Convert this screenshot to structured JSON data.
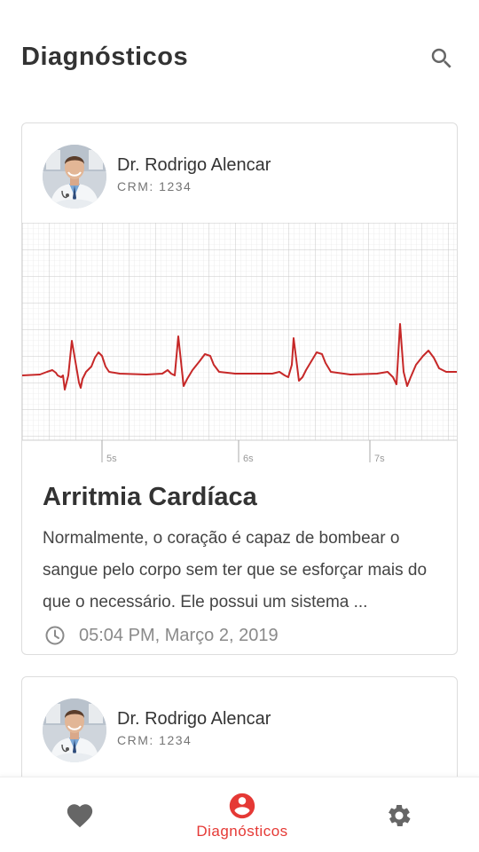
{
  "header": {
    "title": "Diagnósticos",
    "search_icon": "search-icon"
  },
  "cards": [
    {
      "doctor": {
        "name": "Dr. Rodrigo Alencar",
        "crm": "CRM: 1234"
      },
      "ecg_ticks": [
        "5s",
        "6s",
        "7s"
      ],
      "diagnosis": {
        "title": "Arritmia Cardíaca",
        "description": "Normalmente, o coração é capaz de bombear o sangue pelo corpo sem ter que se esforçar mais do que o necessário. Ele possui um sistema ...",
        "timestamp": "05:04 PM, Março 2, 2019"
      }
    },
    {
      "doctor": {
        "name": "Dr. Rodrigo Alencar",
        "crm": "CRM: 1234"
      }
    }
  ],
  "bottom_nav": {
    "items": [
      {
        "icon": "heart-icon",
        "label": "",
        "active": false
      },
      {
        "icon": "account-circle-icon",
        "label": "Diagnósticos",
        "active": true
      },
      {
        "icon": "gear-icon",
        "label": "",
        "active": false
      }
    ]
  },
  "colors": {
    "accent": "#e53935",
    "ecg_line": "#c62828",
    "title_text": "#333333",
    "muted_text": "#757575"
  }
}
